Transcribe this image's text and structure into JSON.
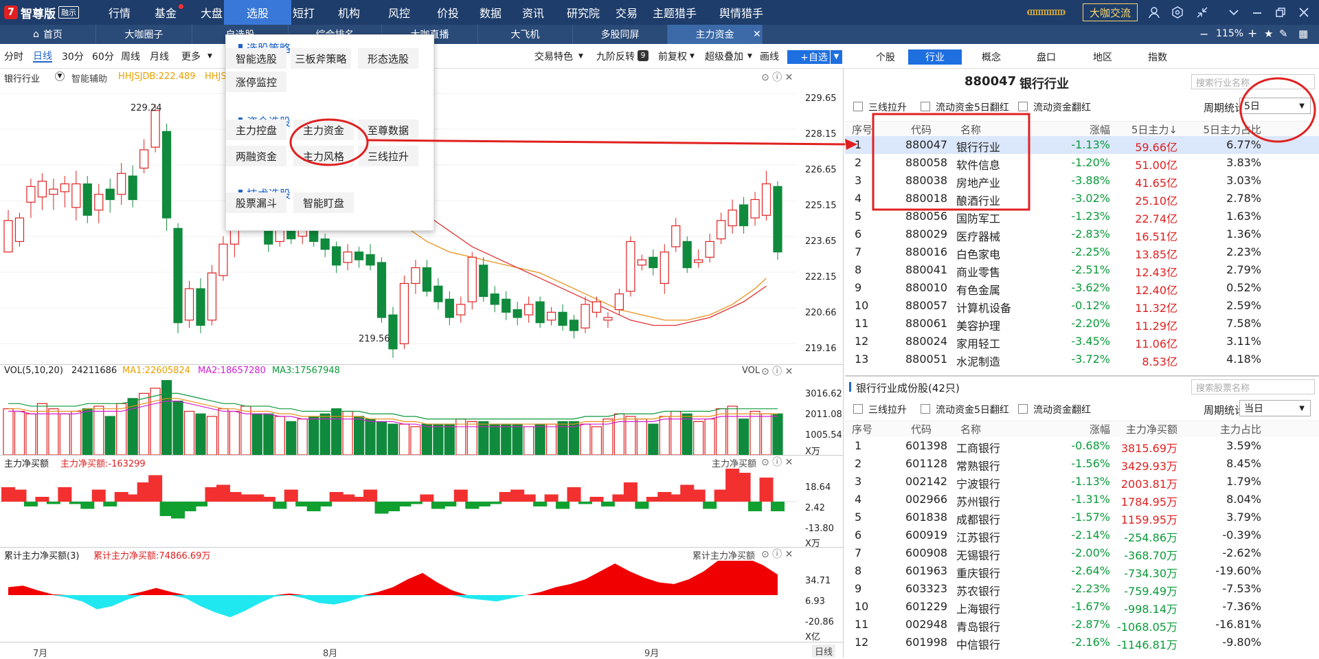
{
  "app": {
    "brand": "智尊版",
    "badge": "融示",
    "exchange": "大咖交流",
    "zoom": "115%"
  },
  "menus": [
    "行情",
    "基金",
    "大盘",
    "选股",
    "短打",
    "机构",
    "风控",
    "价投",
    "数据",
    "资讯",
    "研究院",
    "交易",
    "主题猎手",
    "舆情猎手"
  ],
  "active_menu": "选股",
  "tabs": [
    "首页",
    "大咖圈子",
    "自选股",
    "综合排名",
    "大咖直播",
    "大飞机",
    "多股同屏",
    "主力资金"
  ],
  "toolbar": {
    "periods": [
      "分时",
      "日线",
      "30分",
      "60分",
      "周线",
      "月线",
      "更多"
    ],
    "selected": "日线",
    "right": [
      "交易特色",
      "九阶反转",
      "前复权",
      "超级叠加",
      "画线"
    ],
    "badge9": "9",
    "add_fav": "+自选"
  },
  "rtabs": [
    "个股",
    "行业",
    "概念",
    "盘口",
    "地区",
    "指数"
  ],
  "rtab_selected": "行业",
  "chart": {
    "code_label": "银行行业",
    "assist": "智能辅助",
    "indicator": "HHJSJDB:222.489",
    "indicator2": "HHJS",
    "price_axis": [
      "229.65",
      "228.15",
      "226.65",
      "225.15",
      "223.65",
      "222.15",
      "220.66",
      "219.16"
    ],
    "high_label": "229.24",
    "low_label": "219.56",
    "vol_title": "VOL(5,10,20)",
    "vol_value": "24211686",
    "ma1": "MA1:22605824",
    "ma2": "MA2:18657280",
    "ma3": "MA3:17567948",
    "vol_tag": "VOL",
    "vol_axis": [
      "3016.62",
      "2011.08",
      "1005.54",
      "X万"
    ],
    "mf_title": "主力净买额",
    "mf_value": "主力净买额:-163299",
    "mf_tag": "主力净买额",
    "mf_axis": [
      "18.64",
      "2.42",
      "-13.80",
      "X万"
    ],
    "cum_title": "累计主力净买额(3)",
    "cum_value": "累计主力净买额:74866.69万",
    "cum_tag": "累计主力净买额",
    "cum_axis": [
      "34.71",
      "6.93",
      "-20.86",
      "X亿"
    ],
    "months": [
      "7月",
      "8月",
      "9月"
    ],
    "day_tag": "日线"
  },
  "popup": {
    "h1": "选股策略",
    "g1": [
      "智能选股",
      "三板斧策略",
      "形态选股",
      "涨停监控"
    ],
    "h2": "资金选股",
    "g2": [
      "主力控盘",
      "主力资金",
      "至尊数据",
      "两融资金",
      "主力风格",
      "三线拉升"
    ],
    "h3": "技术选股",
    "g3": [
      "股票漏斗",
      "智能盯盘"
    ]
  },
  "industry": {
    "code": "880047",
    "name": "银行行业",
    "search": "搜索行业名称",
    "filters": [
      "三线拉升",
      "流动资金5日翻红",
      "流动资金翻红"
    ],
    "period_label": "周期统计:",
    "period": "5日",
    "headers": [
      "序号",
      "代码",
      "名称",
      "涨幅",
      "5日主力↓",
      "5日主力占比"
    ],
    "rows": [
      [
        "1",
        "880047",
        "银行行业",
        "-1.13%",
        "59.66亿",
        "6.77%"
      ],
      [
        "2",
        "880058",
        "软件信息",
        "-1.20%",
        "51.00亿",
        "3.83%"
      ],
      [
        "3",
        "880038",
        "房地产业",
        "-3.88%",
        "41.65亿",
        "3.03%"
      ],
      [
        "4",
        "880018",
        "酿酒行业",
        "-3.02%",
        "25.10亿",
        "2.78%"
      ],
      [
        "5",
        "880056",
        "国防军工",
        "-1.23%",
        "22.74亿",
        "1.63%"
      ],
      [
        "6",
        "880029",
        "医疗器械",
        "-2.83%",
        "16.51亿",
        "1.36%"
      ],
      [
        "7",
        "880016",
        "白色家电",
        "-2.25%",
        "13.85亿",
        "2.23%"
      ],
      [
        "8",
        "880041",
        "商业零售",
        "-2.51%",
        "12.43亿",
        "2.79%"
      ],
      [
        "9",
        "880010",
        "有色金属",
        "-3.62%",
        "12.40亿",
        "0.52%"
      ],
      [
        "10",
        "880057",
        "计算机设备",
        "-0.12%",
        "11.32亿",
        "2.59%"
      ],
      [
        "11",
        "880061",
        "美容护理",
        "-2.20%",
        "11.29亿",
        "7.58%"
      ],
      [
        "12",
        "880024",
        "家用轻工",
        "-3.45%",
        "11.06亿",
        "3.11%"
      ],
      [
        "13",
        "880051",
        "水泥制造",
        "-3.72%",
        "8.53亿",
        "4.18%"
      ]
    ]
  },
  "stocks": {
    "title": "银行行业成份股(42只)",
    "search": "搜索股票名称",
    "filters": [
      "三线拉升",
      "流动资金5日翻红",
      "流动资金翻红"
    ],
    "period_label": "周期统计:",
    "period": "当日",
    "headers": [
      "序号",
      "代码",
      "名称",
      "涨幅",
      "主力净买额",
      "主力占比"
    ],
    "rows": [
      [
        "1",
        "601398",
        "工商银行",
        "-0.68%",
        "3815.69万",
        "3.59%"
      ],
      [
        "2",
        "601128",
        "常熟银行",
        "-1.56%",
        "3429.93万",
        "8.45%"
      ],
      [
        "3",
        "002142",
        "宁波银行",
        "-1.13%",
        "2003.81万",
        "1.79%"
      ],
      [
        "4",
        "002966",
        "苏州银行",
        "-1.31%",
        "1784.95万",
        "8.04%"
      ],
      [
        "5",
        "601838",
        "成都银行",
        "-1.57%",
        "1159.95万",
        "3.79%"
      ],
      [
        "6",
        "600919",
        "江苏银行",
        "-2.14%",
        "-254.86万",
        "-0.39%"
      ],
      [
        "7",
        "600908",
        "无锡银行",
        "-2.00%",
        "-368.70万",
        "-2.62%"
      ],
      [
        "8",
        "601963",
        "重庆银行",
        "-2.64%",
        "-734.30万",
        "-19.60%"
      ],
      [
        "9",
        "603323",
        "苏农银行",
        "-2.23%",
        "-759.49万",
        "-7.53%"
      ],
      [
        "10",
        "601229",
        "上海银行",
        "-1.67%",
        "-998.14万",
        "-7.36%"
      ],
      [
        "11",
        "002948",
        "青岛银行",
        "-2.87%",
        "-1068.05万",
        "-16.81%"
      ],
      [
        "12",
        "601998",
        "中信银行",
        "-2.16%",
        "-1146.81万",
        "-9.80%"
      ]
    ]
  },
  "chart_data": {
    "type": "candlestick",
    "ylim": [
      219.16,
      229.65
    ],
    "candles": [
      [
        223.6,
        224.8,
        224.3,
        225.2
      ],
      [
        224.0,
        224.9,
        223.8,
        225.1
      ],
      [
        225.5,
        226.1,
        224.9,
        226.4
      ],
      [
        225.7,
        226.3,
        225.2,
        226.6
      ],
      [
        225.8,
        226.0,
        225.2,
        226.4
      ],
      [
        225.9,
        226.2,
        225.3,
        226.5
      ],
      [
        225.3,
        226.2,
        224.8,
        226.7
      ],
      [
        226.2,
        225.0,
        224.7,
        226.5
      ],
      [
        225.2,
        225.8,
        224.7,
        226.2
      ],
      [
        226.0,
        225.6,
        225.1,
        226.4
      ],
      [
        225.8,
        226.6,
        225.4,
        227.0
      ],
      [
        226.5,
        225.6,
        225.3,
        226.9
      ],
      [
        226.8,
        227.5,
        226.6,
        227.9
      ],
      [
        227.6,
        229.0,
        227.4,
        229.24
      ],
      [
        228.2,
        224.9,
        224.4,
        228.5
      ],
      [
        224.5,
        220.9,
        220.5,
        224.7
      ],
      [
        221.0,
        222.2,
        220.7,
        222.5
      ],
      [
        222.2,
        220.8,
        220.5,
        222.6
      ],
      [
        221.0,
        222.8,
        220.8,
        223.1
      ],
      [
        222.7,
        223.9,
        222.5,
        224.2
      ],
      [
        223.9,
        225.0,
        223.4,
        225.3
      ],
      [
        225.1,
        226.1,
        224.6,
        226.4
      ],
      [
        226.2,
        224.8,
        224.6,
        226.6
      ],
      [
        224.9,
        223.9,
        223.6,
        225.2
      ],
      [
        224.0,
        224.6,
        223.8,
        224.9
      ],
      [
        224.7,
        224.1,
        223.9,
        225.0
      ],
      [
        224.2,
        225.2,
        223.9,
        225.5
      ],
      [
        224.5,
        224.0,
        223.8,
        224.8
      ],
      [
        224.1,
        223.7,
        223.4,
        224.3
      ],
      [
        223.8,
        223.1,
        222.8,
        224.0
      ],
      [
        223.2,
        223.6,
        222.9,
        223.9
      ],
      [
        223.6,
        223.3,
        223.0,
        223.8
      ],
      [
        223.5,
        223.1,
        222.9,
        223.9
      ],
      [
        223.2,
        221.1,
        220.9,
        223.4
      ],
      [
        221.2,
        219.9,
        219.56,
        221.5
      ],
      [
        220.1,
        222.4,
        219.9,
        222.7
      ],
      [
        222.4,
        223.0,
        222.0,
        223.3
      ],
      [
        223.0,
        222.1,
        221.9,
        223.3
      ],
      [
        222.3,
        221.7,
        221.4,
        222.6
      ],
      [
        221.8,
        221.1,
        220.8,
        222.1
      ],
      [
        221.2,
        221.6,
        220.9,
        221.9
      ],
      [
        221.7,
        223.4,
        221.4,
        223.6
      ],
      [
        223.1,
        221.9,
        221.7,
        223.4
      ],
      [
        222.0,
        221.6,
        221.3,
        222.3
      ],
      [
        221.8,
        221.3,
        221.0,
        222.1
      ],
      [
        221.4,
        221.1,
        220.8,
        221.7
      ],
      [
        221.2,
        221.6,
        220.9,
        221.9
      ],
      [
        221.7,
        220.9,
        220.7,
        221.9
      ],
      [
        221.0,
        221.3,
        220.8,
        221.5
      ],
      [
        221.3,
        220.8,
        220.6,
        221.6
      ],
      [
        221.0,
        220.6,
        220.3,
        221.2
      ],
      [
        220.7,
        221.6,
        220.5,
        221.9
      ],
      [
        221.3,
        221.7,
        221.1,
        221.9
      ],
      [
        221.0,
        221.1,
        220.7,
        221.3
      ],
      [
        221.4,
        222.0,
        221.2,
        222.2
      ],
      [
        222.1,
        224.0,
        221.9,
        224.2
      ],
      [
        223.1,
        223.3,
        222.9,
        223.5
      ],
      [
        223.4,
        223.0,
        222.7,
        223.7
      ],
      [
        222.4,
        223.6,
        222.0,
        223.9
      ],
      [
        223.8,
        224.6,
        223.6,
        224.9
      ],
      [
        224.0,
        223.0,
        222.8,
        224.2
      ],
      [
        223.2,
        223.3,
        223.0,
        223.7
      ],
      [
        223.4,
        224.0,
        223.2,
        224.3
      ],
      [
        224.1,
        224.8,
        223.9,
        225.1
      ],
      [
        224.6,
        225.2,
        224.3,
        225.6
      ],
      [
        225.4,
        224.6,
        224.3,
        225.7
      ],
      [
        224.9,
        225.6,
        224.6,
        225.9
      ],
      [
        225.0,
        226.2,
        224.8,
        226.7
      ],
      [
        226.1,
        223.6,
        223.3,
        226.3
      ]
    ],
    "ma_short": [
      225.6,
      225.7,
      225.8,
      225.9,
      226.0,
      226.0,
      225.9,
      225.8,
      225.7,
      225.6,
      225.5,
      225.2,
      224.9,
      224.6,
      224.3,
      224.0,
      223.8,
      223.6,
      223.5,
      223.4,
      223.3,
      223.2,
      223.1,
      223.0,
      222.9,
      222.8,
      222.6,
      222.4,
      222.2,
      222.0,
      221.8,
      221.6,
      221.4,
      221.3,
      221.2,
      221.1,
      221.0,
      221.0,
      221.0,
      221.1,
      221.2,
      221.4,
      221.6,
      221.9,
      222.2,
      222.6
    ],
    "ma_long": [
      225.2,
      225.4,
      225.6,
      225.7,
      225.8,
      225.8,
      225.6,
      225.4,
      225.2,
      225.0,
      224.7,
      224.4,
      224.1,
      223.8,
      223.6,
      223.4,
      223.2,
      223.0,
      222.8,
      222.6,
      222.4,
      222.2,
      222.0,
      221.8,
      221.6,
      221.4,
      221.2,
      221.0,
      220.9,
      220.8,
      220.8,
      220.8,
      220.9,
      221.0,
      221.1,
      221.3,
      221.5,
      221.7,
      222.0,
      222.3
    ],
    "volume": [
      18,
      17,
      16,
      20,
      18,
      16,
      17,
      18,
      19,
      15,
      20,
      22,
      24,
      26,
      29,
      21,
      17,
      16,
      15,
      18,
      17,
      19,
      16,
      16,
      15,
      13,
      14,
      15,
      16,
      18,
      17,
      15,
      14,
      13,
      12,
      12,
      11,
      12,
      12,
      12,
      14,
      13,
      13,
      12,
      12,
      12,
      11,
      12,
      12,
      13,
      13,
      12,
      11,
      14,
      16,
      15,
      14,
      12,
      15,
      17,
      16,
      13,
      14,
      18,
      19,
      14,
      17,
      16,
      16
    ],
    "vol_ma": [
      18,
      18,
      17,
      17,
      17,
      17,
      17,
      18,
      18,
      18,
      18,
      19,
      20,
      21,
      22,
      22,
      21,
      20,
      19,
      18,
      18,
      17,
      17,
      17,
      16,
      16,
      15,
      15,
      15,
      15,
      15,
      15,
      14,
      14,
      14,
      13,
      13,
      12,
      12,
      12,
      12,
      12,
      12,
      12,
      12,
      12,
      12,
      12,
      12,
      12,
      12,
      13,
      13,
      13,
      14,
      14,
      14,
      14,
      15,
      15,
      15,
      15,
      15,
      16,
      16,
      16,
      16,
      16,
      16
    ],
    "netflow": [
      6,
      5,
      -2,
      2,
      -1,
      6,
      -1,
      -3,
      5,
      -2,
      4,
      3,
      8,
      11,
      -6,
      -7,
      -4,
      -2,
      6,
      7,
      4,
      3,
      3,
      2,
      -3,
      5,
      -2,
      -4,
      -2,
      4,
      3,
      2,
      5,
      -5,
      -4,
      -2,
      -1,
      3,
      -3,
      -2,
      5,
      -3,
      -2,
      -1,
      4,
      5,
      3,
      -2,
      3,
      -3,
      6,
      -1,
      2,
      -2,
      3,
      8,
      -3,
      2,
      4,
      3,
      7,
      5,
      -3,
      5,
      14,
      12,
      -4,
      10,
      -4
    ],
    "cumulative": [
      10,
      12,
      6,
      1,
      -3,
      -8,
      -18,
      -14,
      -6,
      4,
      9,
      4,
      -4,
      -14,
      -22,
      -28,
      -20,
      -10,
      -2,
      2,
      -4,
      -10,
      -12,
      -8,
      -2,
      4,
      10,
      20,
      28,
      16,
      6,
      -4,
      -6,
      -8,
      -4,
      0,
      4,
      10,
      14,
      20,
      30,
      40,
      30,
      22,
      16,
      14,
      20,
      30,
      44,
      52,
      46,
      38,
      26
    ]
  }
}
